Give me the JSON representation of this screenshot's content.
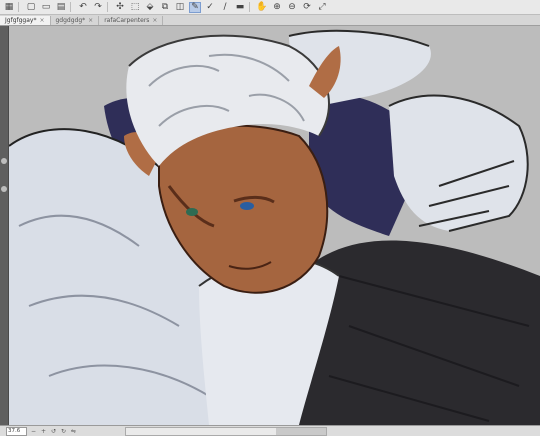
{
  "toolbar": {
    "icons": [
      "new-file-icon",
      "open-file-icon",
      "save-icon",
      "undo-icon",
      "redo-icon",
      "select-icon",
      "fill-icon",
      "transform-icon",
      "pen-icon",
      "eraser-icon",
      "check-icon",
      "brush-icon",
      "zoom-in-icon",
      "zoom-out-icon",
      "fit-icon"
    ]
  },
  "tabs": [
    {
      "label": "Jgfgfggay*"
    },
    {
      "label": "gdgdgdg*"
    },
    {
      "label": "rafaCarpenters"
    }
  ],
  "status": {
    "zoom_value": "37.6"
  },
  "colors": {
    "canvas_bg": "#bcbcbc",
    "skin": "#a5653f",
    "hair": "#e8eaee",
    "jacket": "#2b2a2e",
    "fabric": "#d9dee7",
    "navy": "#2f2e58"
  }
}
